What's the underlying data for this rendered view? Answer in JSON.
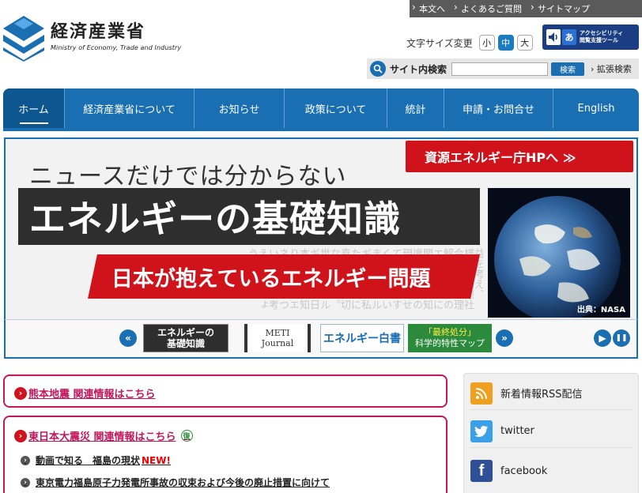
{
  "utility": {
    "links": [
      "本文へ",
      "よくあるご質問",
      "サイトマップ"
    ]
  },
  "logo": {
    "jp": "経済産業省",
    "en": "Ministry of Economy, Trade and Industry"
  },
  "fontsize": {
    "label": "文字サイズ変更",
    "small": "小",
    "medium": "中",
    "large": "大",
    "selected": "中"
  },
  "accessibility": {
    "line1": "アクセシビリティ",
    "line2": "閲覧支援ツール"
  },
  "search": {
    "label": "サイト内検索",
    "value": "",
    "button": "検索",
    "advanced": "拡張検索"
  },
  "nav": {
    "items": [
      "ホーム",
      "経済産業省について",
      "お知らせ",
      "政策について",
      "統計",
      "申請・お問合せ",
      "English"
    ],
    "active": "ホーム"
  },
  "hero": {
    "subtitle": "ニュースだけでは分からない",
    "title": "エネルギーの基礎知識",
    "band": "日本が抱えているエネルギー問題",
    "cta": "資源エネルギー庁HPへ ≫",
    "credit": "出典：NASA",
    "background_text": "益を考え、様々な国際社会の動きを理解するためのエネルギーに関する基礎知識を、日本の現状とあわせて分かりやすく紹介しています。エネルギー問題は私たちの生活に直結する大切な課題です。世界のエネルギー情勢と日本の取組を知り、未来のエネルギーについて一緒に考えてみましょう。"
  },
  "carousel": {
    "prev": "«",
    "next": "»",
    "play": "▶",
    "pause": "❚❚",
    "thumbs": {
      "t1_line1": "エネルギーの",
      "t1_line2": "基礎知識",
      "t2_line1": "METI",
      "t2_line2": "Journal",
      "t3": "エネルギー白書",
      "t4_line1": "「最終処分」",
      "t4_line2": "科学的特性マップ"
    }
  },
  "notices": {
    "n1": "熊本地震 関連情報はこちら",
    "n2": "東日本大震災 関連情報はこちら",
    "n2_badge": "復",
    "links": [
      "動画で知る　福島の現状",
      "東京電力福島原子力発電所事故の収束および今後の廃止措置に向けて"
    ],
    "new_label": "NEW!"
  },
  "social": {
    "items": [
      "新着情報RSS配信",
      "twitter",
      "facebook"
    ]
  },
  "colors": {
    "brand_blue": "#1a6fb3",
    "red": "#d0121b",
    "notice_pink": "#c2185b"
  }
}
